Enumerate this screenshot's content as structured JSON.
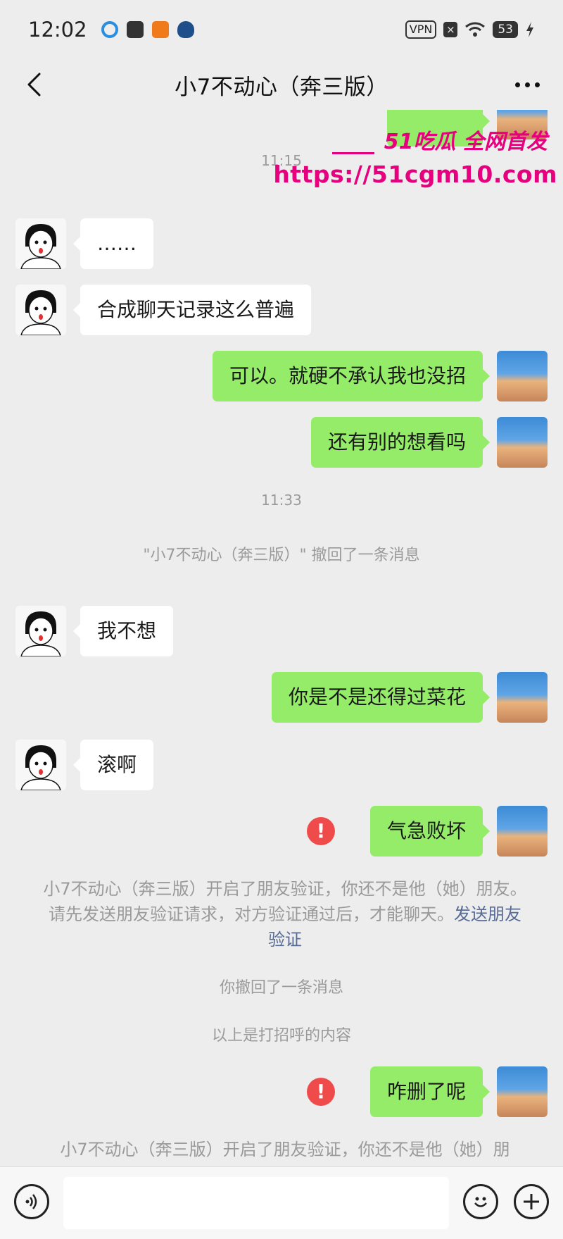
{
  "status_bar": {
    "time": "12:02",
    "vpn_label": "VPN",
    "battery": "53",
    "icons": [
      "browser-icon",
      "app-icon",
      "app-icon",
      "cat-icon",
      "vpn-icon",
      "close-icon",
      "wifi-icon",
      "battery-icon",
      "charging-icon"
    ]
  },
  "header": {
    "title": "小7不动心（奔三版）"
  },
  "watermark": {
    "line1": "51吃瓜 全网首发",
    "line2": "https://51cgm10.com"
  },
  "messages": {
    "time_1115": "11:15",
    "m1": "……",
    "m2": "合成聊天记录这么普遍",
    "m3": "可以。就硬不承认我也没招",
    "m4": "还有别的想看吗",
    "time_1133": "11:33",
    "recall_notice": "\"小7不动心（奔三版）\" 撤回了一条消息",
    "m5": "我不想",
    "m6": "你是不是还得过菜花",
    "m7": "滚啊",
    "m8": "气急败坏",
    "verify_notice_text": "小7不动心（奔三版）开启了朋友验证，你还不是他（她）朋友。请先发送朋友验证请求，对方验证通过后，才能聊天。",
    "verify_link": "发送朋友验证",
    "you_recalled": "你撤回了一条消息",
    "greeting_notice": "以上是打招呼的内容",
    "m9": "咋删了呢",
    "verify_notice_text_2": "小7不动心（奔三版）开启了朋友验证，你还不是他（她）朋",
    "fail_mark": "!"
  },
  "colors": {
    "background": "#ededed",
    "sent_bubble": "#95ec69",
    "received_bubble": "#ffffff",
    "link": "#576b95",
    "error": "#f04b4b",
    "watermark": "#e6007e"
  }
}
